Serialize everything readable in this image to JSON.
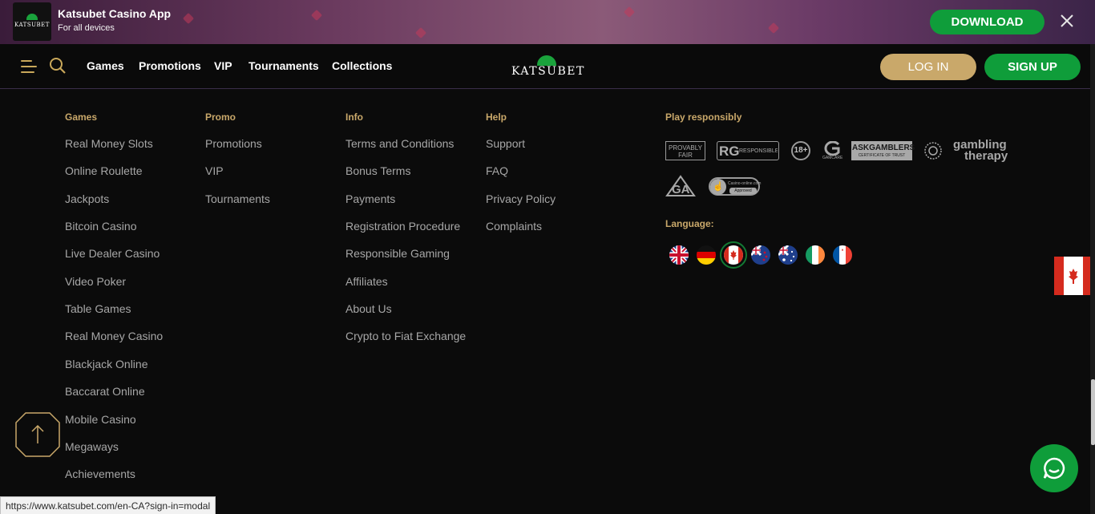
{
  "app_banner": {
    "title": "Katsubet Casino App",
    "subtitle": "For all devices",
    "logo_text": "KATSUBET",
    "download_label": "DOWNLOAD",
    "close_icon": "close-icon"
  },
  "header": {
    "nav": [
      "Games",
      "Promotions",
      "VIP",
      "Tournaments",
      "Collections"
    ],
    "brand": "KATSUBET",
    "login_label": "LOG IN",
    "signup_label": "SIGN UP"
  },
  "footer": {
    "games": {
      "heading": "Games",
      "links": [
        "Real Money Slots",
        "Online Roulette",
        "Jackpots",
        "Bitcoin Casino",
        "Live Dealer Casino",
        "Video Poker",
        "Table Games",
        "Real Money Casino",
        "Blackjack Online",
        "Baccarat Online",
        "Mobile Casino",
        "Megaways",
        "Achievements"
      ]
    },
    "promo": {
      "heading": "Promo",
      "links": [
        "Promotions",
        "VIP",
        "Tournaments"
      ]
    },
    "info": {
      "heading": "Info",
      "links": [
        "Terms and Conditions",
        "Bonus Terms",
        "Payments",
        "Registration Procedure",
        "Responsible Gaming",
        "Affiliates",
        "About Us",
        "Crypto to Fiat Exchange"
      ]
    },
    "help": {
      "heading": "Help",
      "links": [
        "Support",
        "FAQ",
        "Privacy Policy",
        "Complaints"
      ]
    },
    "responsible": {
      "heading": "Play responsibly",
      "badges": {
        "provably_fair": "PROVABLY FAIR",
        "rg": "RESPONSIBLE GAMING",
        "age": "18+",
        "gamcare": "GAMCARE",
        "askgamblers": "ASKGAMBLERS",
        "askgamblers_sub": "CERTIFICATE OF TRUST",
        "gambling_therapy_1": "gambling",
        "gambling_therapy_2": "therapy",
        "casino_online": "Casino-online.com",
        "approved": "Approved"
      }
    },
    "language": {
      "heading": "Language:",
      "flags": [
        "uk-flag-icon",
        "germany-flag-icon",
        "canada-flag-icon",
        "new-zealand-flag-icon",
        "australia-flag-icon",
        "ireland-flag-icon",
        "france-flag-icon"
      ],
      "selected": "canada-flag-icon"
    }
  },
  "status_bar": {
    "url": "https://www.katsubet.com/en-CA?sign-in=modal"
  },
  "colors": {
    "gold": "#c9a86a",
    "green": "#0f9d3a",
    "link": "#a7a7a7",
    "bg": "#0b0b0b"
  }
}
